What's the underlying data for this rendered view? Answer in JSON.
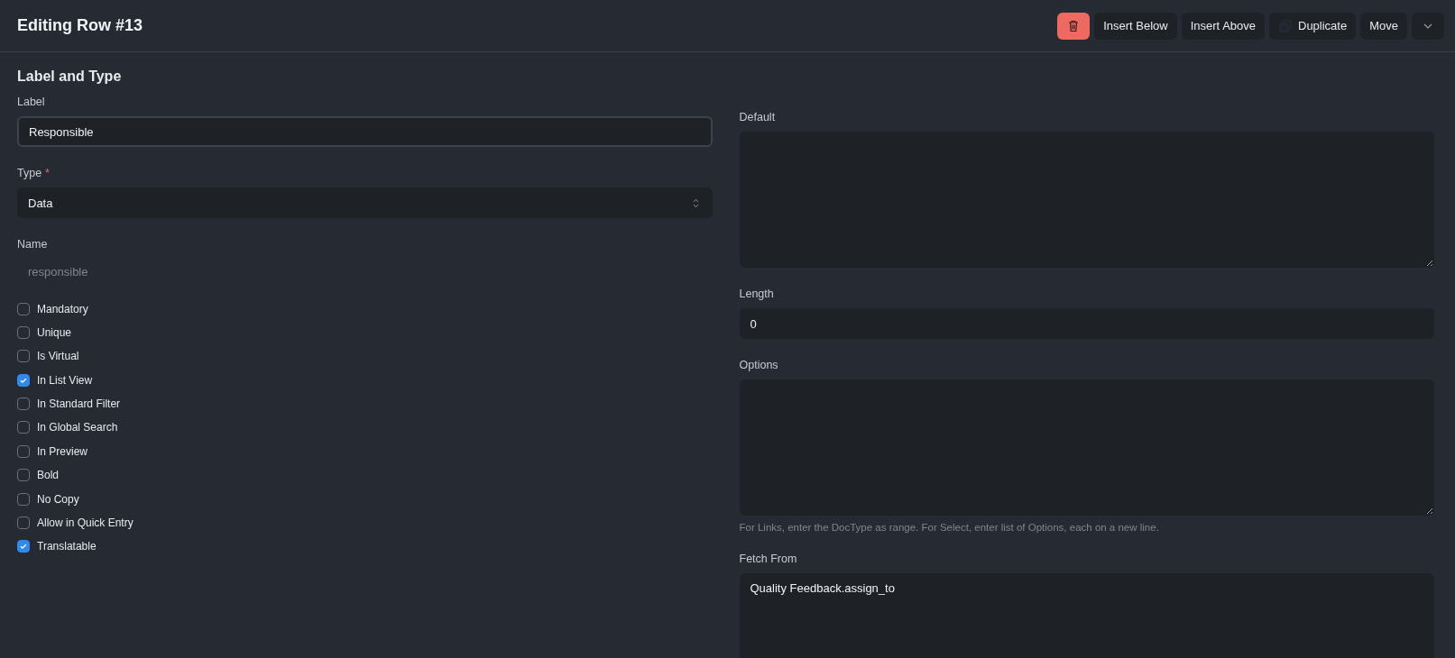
{
  "header": {
    "title": "Editing Row #13",
    "buttons": [
      {
        "kind": "delete"
      },
      {
        "kind": "text",
        "label": "Insert Below"
      },
      {
        "kind": "text",
        "label": "Insert Above"
      },
      {
        "kind": "copy",
        "label": "Duplicate"
      },
      {
        "kind": "text",
        "label": "Move"
      },
      {
        "kind": "dropdown"
      }
    ]
  },
  "section": {
    "title": "Label and Type"
  },
  "left_fields": [
    {
      "kind": "text",
      "label": "Label",
      "value": "Responsible",
      "focused": true
    },
    {
      "kind": "select",
      "label": "Type",
      "required_mark": "*",
      "value": "Data",
      "focused": false
    },
    {
      "kind": "static",
      "label": "Name",
      "placeholder": "responsible",
      "focused": false
    }
  ],
  "checkboxes": [
    {
      "label": "Mandatory",
      "checked": false
    },
    {
      "label": "Unique",
      "checked": false
    },
    {
      "label": "Is Virtual",
      "checked": false
    },
    {
      "label": "In List View",
      "checked": true
    },
    {
      "label": "In Standard Filter",
      "checked": false
    },
    {
      "label": "In Global Search",
      "checked": false
    },
    {
      "label": "In Preview",
      "checked": false
    },
    {
      "label": "Bold",
      "checked": false
    },
    {
      "label": "No Copy",
      "checked": false
    },
    {
      "label": "Allow in Quick Entry",
      "checked": false
    },
    {
      "label": "Translatable",
      "checked": true
    }
  ],
  "right_fields": [
    {
      "kind": "textarea",
      "label": "Default"
    },
    {
      "kind": "text",
      "label": "Length",
      "value": "0"
    },
    {
      "kind": "textarea",
      "label": "Options",
      "description": "For Links, enter the DocType as range. For Select, enter list of Options, each on a new line."
    },
    {
      "kind": "tall",
      "label": "Fetch From",
      "value": "Quality Feedback.assign_to"
    }
  ]
}
